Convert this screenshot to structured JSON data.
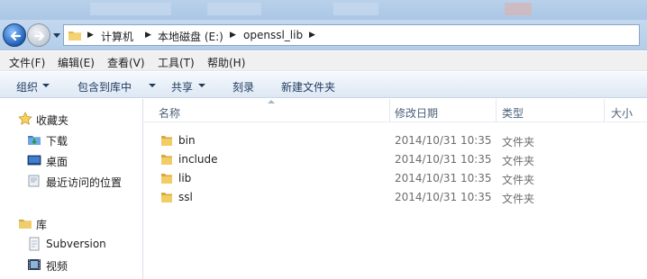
{
  "address": {
    "crumbs": [
      "计算机",
      "本地磁盘 (E:)",
      "openssl_lib"
    ]
  },
  "menu": [
    "文件(F)",
    "编辑(E)",
    "查看(V)",
    "工具(T)",
    "帮助(H)"
  ],
  "commands": {
    "organize": "组织",
    "include_in_library": "包含到库中",
    "share": "共享",
    "burn": "刻录",
    "new_folder": "新建文件夹"
  },
  "navpane": {
    "favorites": "收藏夹",
    "downloads": "下载",
    "desktop": "桌面",
    "recent": "最近访问的位置",
    "libraries": "库",
    "subversion": "Subversion",
    "videos": "视频"
  },
  "columns": {
    "name": "名称",
    "date_modified": "修改日期",
    "type": "类型",
    "size": "大小"
  },
  "files": [
    {
      "name": "bin",
      "date": "2014/10/31 10:35",
      "type": "文件夹"
    },
    {
      "name": "include",
      "date": "2014/10/31 10:35",
      "type": "文件夹"
    },
    {
      "name": "lib",
      "date": "2014/10/31 10:35",
      "type": "文件夹"
    },
    {
      "name": "ssl",
      "date": "2014/10/31 10:35",
      "type": "文件夹"
    }
  ],
  "icons": {
    "folder": "folder-icon",
    "back": "back-arrow-icon",
    "forward": "forward-arrow-icon"
  }
}
